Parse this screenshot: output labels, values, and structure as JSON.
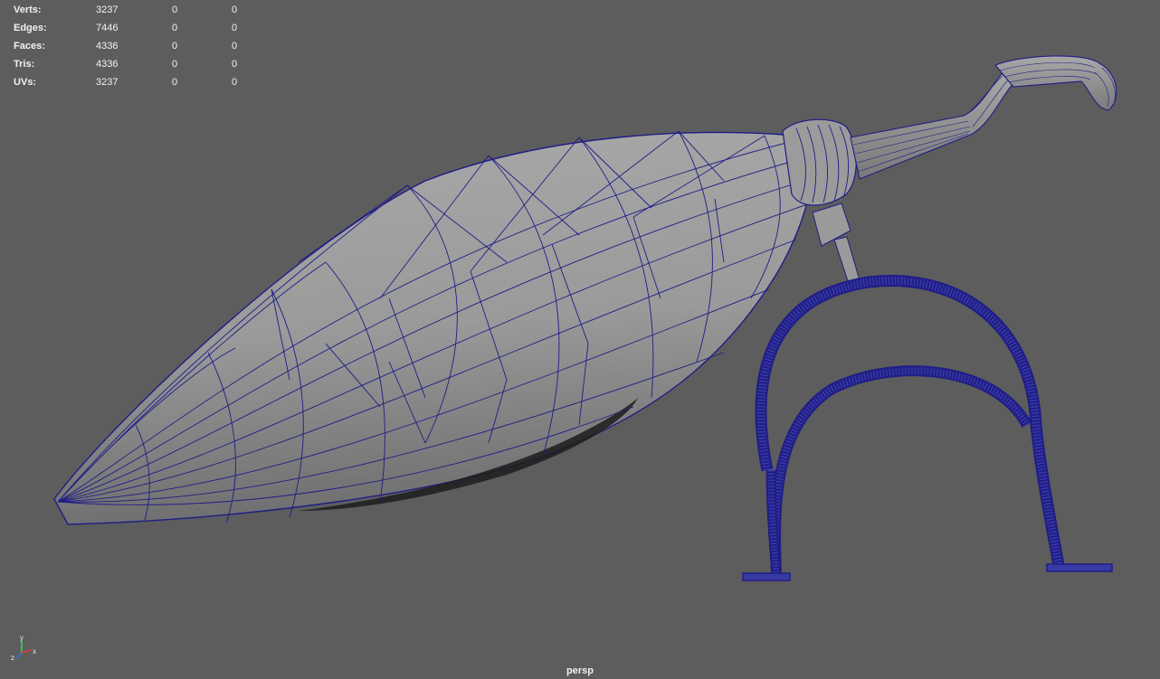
{
  "viewport": {
    "camera_label": "persp",
    "background": "#5d5d5d",
    "wire_color": "#1f1d86",
    "shade_color": "#9d9d9d"
  },
  "hud": {
    "rows": [
      {
        "label": "Verts:",
        "v1": "3237",
        "v2": "0",
        "v3": "0"
      },
      {
        "label": "Edges:",
        "v1": "7446",
        "v2": "0",
        "v3": "0"
      },
      {
        "label": "Faces:",
        "v1": "4336",
        "v2": "0",
        "v3": "0"
      },
      {
        "label": "Tris:",
        "v1": "4336",
        "v2": "0",
        "v3": "0"
      },
      {
        "label": "UVs:",
        "v1": "3237",
        "v2": "0",
        "v3": "0"
      }
    ]
  },
  "axis": {
    "y": "y",
    "x": "x",
    "z": "z"
  }
}
